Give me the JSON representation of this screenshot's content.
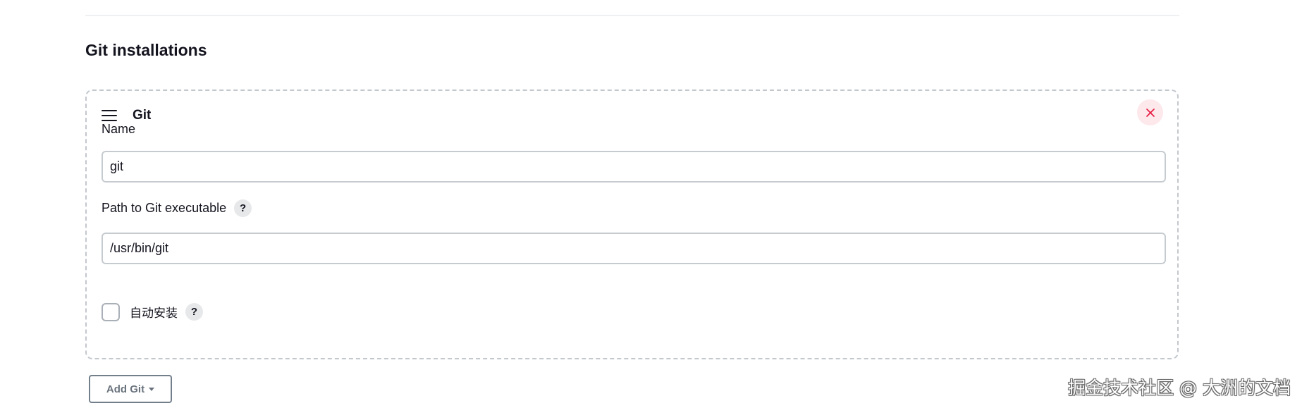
{
  "section": {
    "title": "Git installations"
  },
  "installation": {
    "title": "Git",
    "name_label": "Name",
    "name_value": "git",
    "path_label": "Path to Git executable",
    "path_value": "/usr/bin/git",
    "help_mark": "?",
    "auto_install_label": "自动安装",
    "auto_install_checked": false
  },
  "add_button": {
    "label": "Add Git"
  },
  "watermark": {
    "text": "掘金技术社区 @ 大洲的文档"
  },
  "colors": {
    "delete_icon": "#e6193f",
    "delete_bg": "#fde8ec",
    "border_dashed": "#c3c8cd",
    "text": "#14141f"
  }
}
